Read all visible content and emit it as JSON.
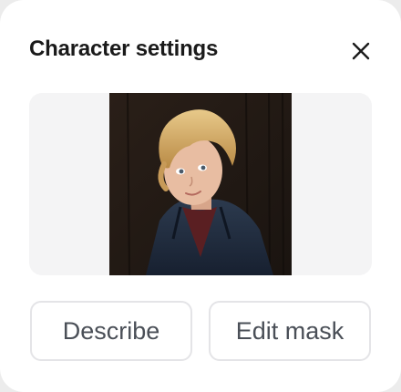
{
  "dialog": {
    "title": "Character settings",
    "close_icon": "close-icon",
    "preview": {
      "image": "character-portrait"
    },
    "actions": {
      "describe_label": "Describe",
      "edit_mask_label": "Edit mask"
    }
  },
  "colors": {
    "background": "#ffffff",
    "preview_bg": "#f4f4f5",
    "button_border": "#e4e4e7",
    "button_text": "#4a4f57",
    "title_text": "#1a1a1a"
  }
}
